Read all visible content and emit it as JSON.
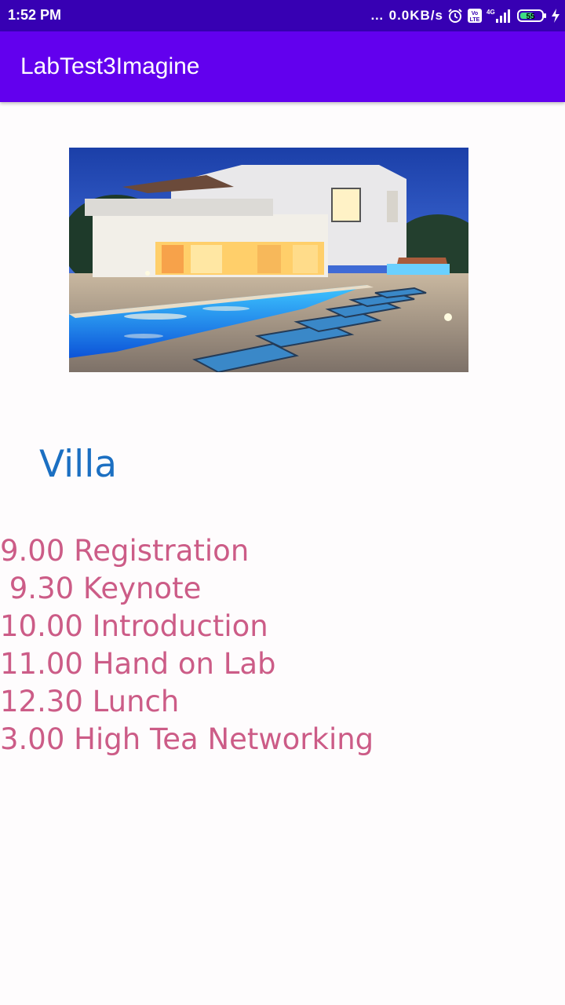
{
  "status_bar": {
    "time": "1:52 PM",
    "network_speed": "… 0.0KB/s",
    "battery_level": "55",
    "icons": [
      "alarm-icon",
      "volte-icon",
      "signal-4g-icon",
      "battery-icon",
      "charging-icon"
    ]
  },
  "app_bar": {
    "title": "LabTest3Imagine",
    "color": "#6200ee",
    "status_color": "#3700b3"
  },
  "hero_image": {
    "subject": "villa with swimming pool at dusk"
  },
  "content": {
    "heading": "Villa",
    "heading_color": "#1b6fc2",
    "agenda_color": "#cc5c87",
    "agenda": [
      "9.00 Registration",
      " 9.30 Keynote",
      "10.00 Introduction",
      "11.00 Hand on Lab",
      "12.30 Lunch",
      "3.00 High Tea Networking"
    ]
  }
}
